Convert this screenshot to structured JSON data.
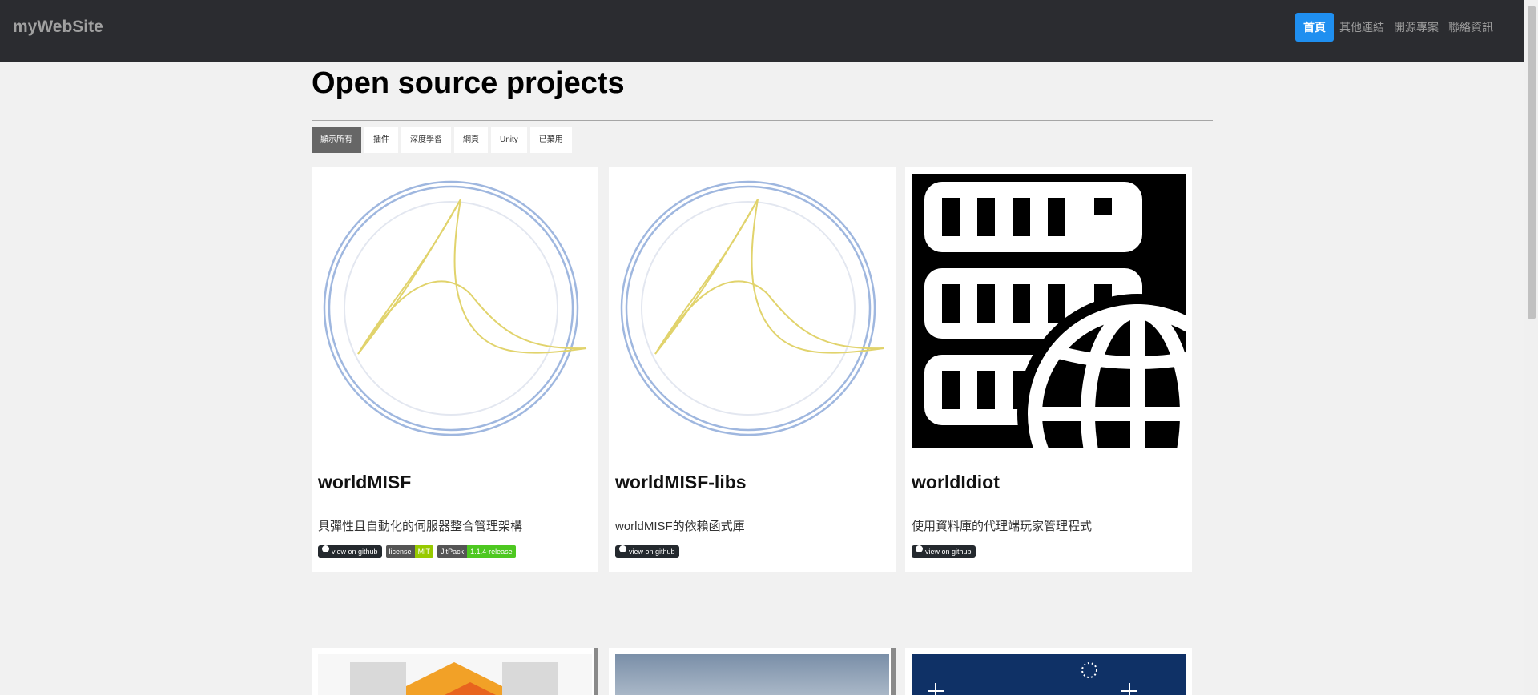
{
  "brand": "myWebSite",
  "nav": [
    {
      "label": "首頁",
      "active": true
    },
    {
      "label": "其他連結",
      "active": false
    },
    {
      "label": "開源專案",
      "active": false
    },
    {
      "label": "聯絡資訊",
      "active": false
    }
  ],
  "page_title": "Open source projects",
  "filters": [
    "顯示所有",
    "插件",
    "深度學習",
    "網頁",
    "Unity",
    "已棄用"
  ],
  "cards": [
    {
      "name": "worldMISF",
      "description": "具彈性且自動化的伺服器整合管理架構",
      "badges": {
        "github": "view on github",
        "license_label": "license",
        "license_value": "MIT",
        "jitpack_label": "JitPack",
        "jitpack_value": "1.1.4-release"
      }
    },
    {
      "name": "worldMISF-libs",
      "description": "worldMISF的依賴函式庫",
      "badges": {
        "github": "view on github"
      }
    },
    {
      "name": "worldIdiot",
      "description": "使用資料庫的代理端玩家管理程式",
      "badges": {
        "github": "view on github"
      }
    }
  ],
  "colors": {
    "topbar": "#2b2c30",
    "nav_active": "#1f8ff0",
    "filter_active": "#666666",
    "license_green": "#97ca00",
    "jitpack_green": "#4dc820"
  }
}
